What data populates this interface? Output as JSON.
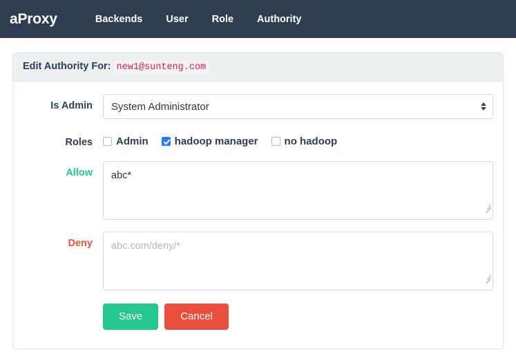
{
  "navbar": {
    "brand": "aProxy",
    "items": [
      {
        "label": "Backends"
      },
      {
        "label": "User"
      },
      {
        "label": "Role"
      },
      {
        "label": "Authority"
      }
    ],
    "background_color": "#2e3e50"
  },
  "panel": {
    "heading_prefix": "Edit Authority For:",
    "heading_email": "new1@sunteng.com",
    "email_color": "#c7254e",
    "email_background": "#f9f2f4"
  },
  "form": {
    "is_admin": {
      "label": "Is Admin",
      "selected": "System Administrator"
    },
    "roles": {
      "label": "Roles",
      "options": [
        {
          "label": "Admin",
          "checked": false
        },
        {
          "label": "hadoop manager",
          "checked": true
        },
        {
          "label": "no hadoop",
          "checked": false
        }
      ],
      "checked_color": "#2b7cf3"
    },
    "allow": {
      "label": "Allow",
      "label_color": "#26c68f",
      "value": "abc*",
      "placeholder": ""
    },
    "deny": {
      "label": "Deny",
      "label_color": "#ef5340",
      "value": "",
      "placeholder": "abc.com/deny/*"
    }
  },
  "buttons": {
    "save": "Save",
    "cancel": "Cancel",
    "save_color": "#26c68f",
    "cancel_color": "#ea4e3d"
  }
}
